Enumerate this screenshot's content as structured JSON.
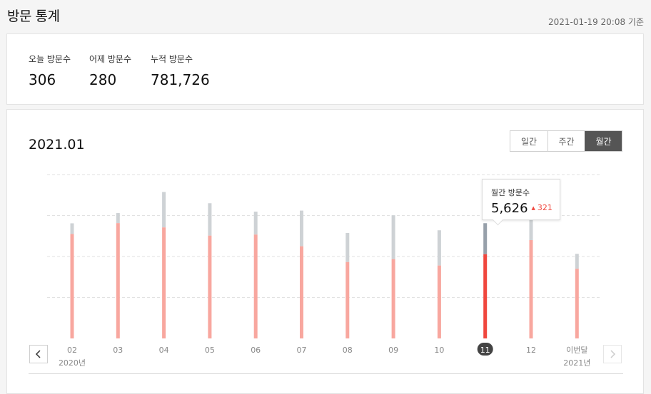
{
  "header": {
    "title": "방문 통계",
    "as_of": "2021-01-19 20:08 기준"
  },
  "stats": [
    {
      "label": "오늘 방문수",
      "value": "306"
    },
    {
      "label": "어제 방문수",
      "value": "280"
    },
    {
      "label": "누적 방문수",
      "value": "781,726"
    }
  ],
  "chart_panel": {
    "period": "2021.01",
    "tabs": [
      {
        "label": "일간",
        "active": false
      },
      {
        "label": "주간",
        "active": false
      },
      {
        "label": "월간",
        "active": true
      }
    ],
    "prev_icon": "chevron-left-icon",
    "next_icon": "chevron-right-icon",
    "tooltip": {
      "label": "월간 방문수",
      "value": "5,626",
      "delta_icon": "triangle-up-icon",
      "delta": "321"
    }
  },
  "chart_data": {
    "type": "bar",
    "categories": [
      "02",
      "03",
      "04",
      "05",
      "06",
      "07",
      "08",
      "09",
      "10",
      "11",
      "12",
      "이번달"
    ],
    "year_labels": {
      "first": "2020년",
      "last": "2021년"
    },
    "selected_index": 9,
    "series": [
      {
        "values": [
          5100,
          5630,
          5420,
          5020,
          5070,
          4500,
          3730,
          3870,
          3560,
          4110,
          4800,
          3400
        ]
      },
      {
        "values": [
          5620,
          6120,
          7150,
          6600,
          6190,
          6240,
          5150,
          6010,
          5280,
          5626,
          5900,
          4130
        ]
      }
    ],
    "grid": true,
    "colors": {
      "bar": "#f8a79f",
      "bar_selected": "#f0473e",
      "bar_previous": "#ced2d5",
      "bar_previous_selected": "#97a0aa",
      "selected_label_bg": "#444444",
      "gridline": "#e2e2e2"
    }
  }
}
